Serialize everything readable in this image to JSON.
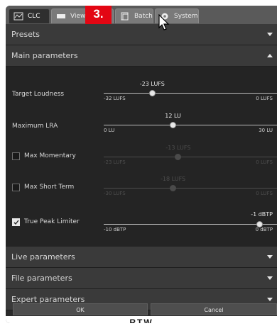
{
  "tabs": [
    {
      "label": "CLC",
      "icon": "clc-icon",
      "active": true
    },
    {
      "label": "View",
      "icon": "view-icon"
    },
    {
      "label": "",
      "icon": "loop-icon"
    },
    {
      "label": "Batch",
      "icon": "batch-icon"
    },
    {
      "label": "System",
      "icon": "gear-icon"
    }
  ],
  "callout": "3.",
  "sections": {
    "presets": "Presets",
    "main": "Main parameters",
    "live": "Live parameters",
    "file": "File parameters",
    "expert": "Expert parameters"
  },
  "params": [
    {
      "label": "Target Loudness",
      "value": "-23 LUFS",
      "min": "-32 LUFS",
      "max": "0 LUFS",
      "fraction": 0.28,
      "enabled": true
    },
    {
      "label": "Maximum LRA",
      "value": "12 LU",
      "min": "0 LU",
      "max": "30 LU",
      "fraction": 0.4,
      "enabled": true
    },
    {
      "label": "Max Momentary",
      "value": "-13 LUFS",
      "min": "-23 LUFS",
      "max": "0 LUFS",
      "fraction": 0.43,
      "enabled": false,
      "checked": false
    },
    {
      "label": "Max Short Term",
      "value": "-18 LUFS",
      "min": "-30 LUFS",
      "max": "0 LUFS",
      "fraction": 0.4,
      "enabled": false,
      "checked": false
    },
    {
      "label": "True Peak Limiter",
      "value": "-1 dBTP",
      "min": "-10 dBTP",
      "max": "0 dBTP",
      "fraction": 0.9,
      "enabled": true,
      "checked": true
    }
  ],
  "buttons": {
    "ok": "OK",
    "cancel": "Cancel"
  },
  "logo": "RTW"
}
